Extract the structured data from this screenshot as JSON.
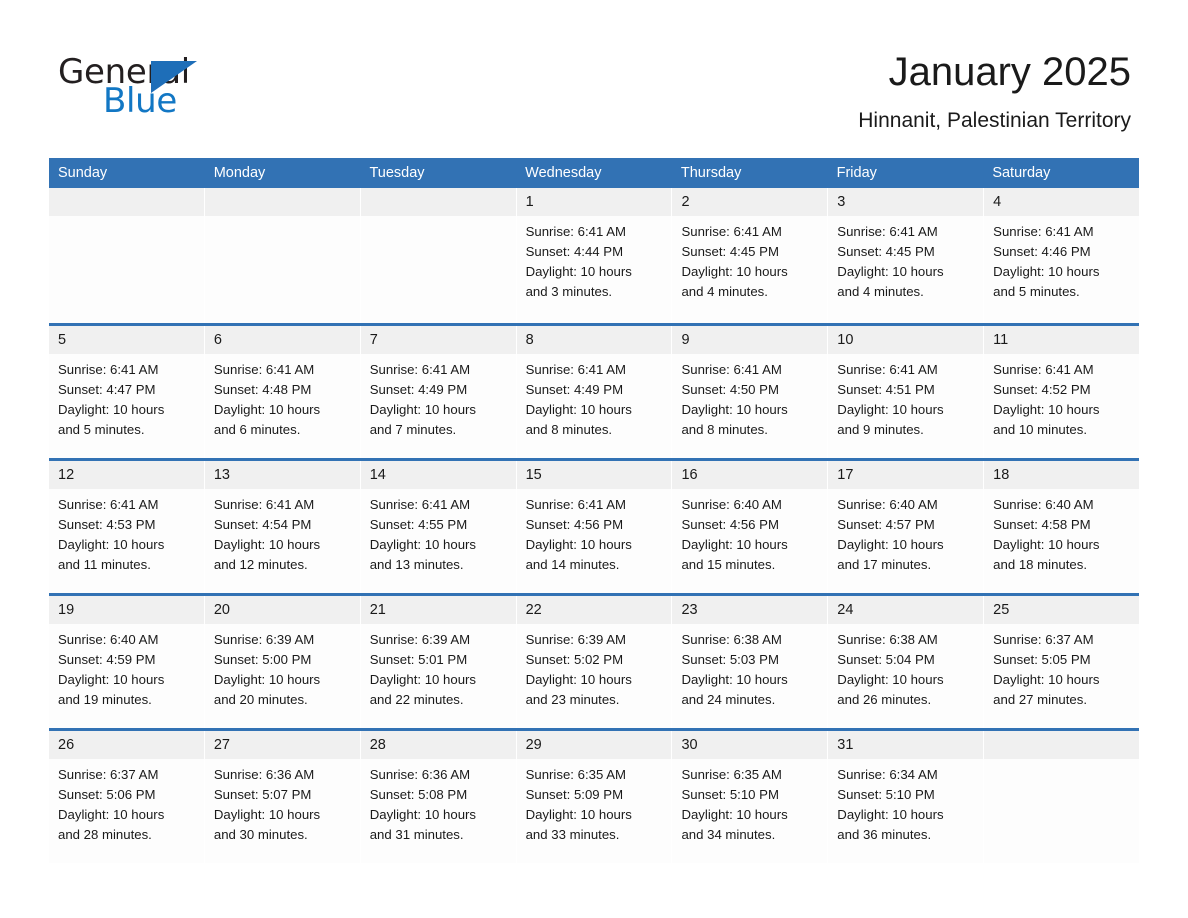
{
  "brand": {
    "word_one": "General",
    "word_two": "Blue",
    "triangle_icon": "triangle-right-icon",
    "accent_color": "#1277c4",
    "triangle_color": "#1e6eb8"
  },
  "header": {
    "title": "January 2025",
    "subtitle": "Hinnanit, Palestinian Territory"
  },
  "calendar": {
    "header_bg": "#3272b4",
    "day_head_bg": "#f0f0f0",
    "weekdays": [
      "Sunday",
      "Monday",
      "Tuesday",
      "Wednesday",
      "Thursday",
      "Friday",
      "Saturday"
    ],
    "weeks": [
      [
        {
          "day": "",
          "empty": true
        },
        {
          "day": "",
          "empty": true
        },
        {
          "day": "",
          "empty": true
        },
        {
          "day": "1",
          "sunrise": "Sunrise: 6:41 AM",
          "sunset": "Sunset: 4:44 PM",
          "daylight_1": "Daylight: 10 hours",
          "daylight_2": "and 3 minutes."
        },
        {
          "day": "2",
          "sunrise": "Sunrise: 6:41 AM",
          "sunset": "Sunset: 4:45 PM",
          "daylight_1": "Daylight: 10 hours",
          "daylight_2": "and 4 minutes."
        },
        {
          "day": "3",
          "sunrise": "Sunrise: 6:41 AM",
          "sunset": "Sunset: 4:45 PM",
          "daylight_1": "Daylight: 10 hours",
          "daylight_2": "and 4 minutes."
        },
        {
          "day": "4",
          "sunrise": "Sunrise: 6:41 AM",
          "sunset": "Sunset: 4:46 PM",
          "daylight_1": "Daylight: 10 hours",
          "daylight_2": "and 5 minutes."
        }
      ],
      [
        {
          "day": "5",
          "sunrise": "Sunrise: 6:41 AM",
          "sunset": "Sunset: 4:47 PM",
          "daylight_1": "Daylight: 10 hours",
          "daylight_2": "and 5 minutes."
        },
        {
          "day": "6",
          "sunrise": "Sunrise: 6:41 AM",
          "sunset": "Sunset: 4:48 PM",
          "daylight_1": "Daylight: 10 hours",
          "daylight_2": "and 6 minutes."
        },
        {
          "day": "7",
          "sunrise": "Sunrise: 6:41 AM",
          "sunset": "Sunset: 4:49 PM",
          "daylight_1": "Daylight: 10 hours",
          "daylight_2": "and 7 minutes."
        },
        {
          "day": "8",
          "sunrise": "Sunrise: 6:41 AM",
          "sunset": "Sunset: 4:49 PM",
          "daylight_1": "Daylight: 10 hours",
          "daylight_2": "and 8 minutes."
        },
        {
          "day": "9",
          "sunrise": "Sunrise: 6:41 AM",
          "sunset": "Sunset: 4:50 PM",
          "daylight_1": "Daylight: 10 hours",
          "daylight_2": "and 8 minutes."
        },
        {
          "day": "10",
          "sunrise": "Sunrise: 6:41 AM",
          "sunset": "Sunset: 4:51 PM",
          "daylight_1": "Daylight: 10 hours",
          "daylight_2": "and 9 minutes."
        },
        {
          "day": "11",
          "sunrise": "Sunrise: 6:41 AM",
          "sunset": "Sunset: 4:52 PM",
          "daylight_1": "Daylight: 10 hours",
          "daylight_2": "and 10 minutes."
        }
      ],
      [
        {
          "day": "12",
          "sunrise": "Sunrise: 6:41 AM",
          "sunset": "Sunset: 4:53 PM",
          "daylight_1": "Daylight: 10 hours",
          "daylight_2": "and 11 minutes."
        },
        {
          "day": "13",
          "sunrise": "Sunrise: 6:41 AM",
          "sunset": "Sunset: 4:54 PM",
          "daylight_1": "Daylight: 10 hours",
          "daylight_2": "and 12 minutes."
        },
        {
          "day": "14",
          "sunrise": "Sunrise: 6:41 AM",
          "sunset": "Sunset: 4:55 PM",
          "daylight_1": "Daylight: 10 hours",
          "daylight_2": "and 13 minutes."
        },
        {
          "day": "15",
          "sunrise": "Sunrise: 6:41 AM",
          "sunset": "Sunset: 4:56 PM",
          "daylight_1": "Daylight: 10 hours",
          "daylight_2": "and 14 minutes."
        },
        {
          "day": "16",
          "sunrise": "Sunrise: 6:40 AM",
          "sunset": "Sunset: 4:56 PM",
          "daylight_1": "Daylight: 10 hours",
          "daylight_2": "and 15 minutes."
        },
        {
          "day": "17",
          "sunrise": "Sunrise: 6:40 AM",
          "sunset": "Sunset: 4:57 PM",
          "daylight_1": "Daylight: 10 hours",
          "daylight_2": "and 17 minutes."
        },
        {
          "day": "18",
          "sunrise": "Sunrise: 6:40 AM",
          "sunset": "Sunset: 4:58 PM",
          "daylight_1": "Daylight: 10 hours",
          "daylight_2": "and 18 minutes."
        }
      ],
      [
        {
          "day": "19",
          "sunrise": "Sunrise: 6:40 AM",
          "sunset": "Sunset: 4:59 PM",
          "daylight_1": "Daylight: 10 hours",
          "daylight_2": "and 19 minutes."
        },
        {
          "day": "20",
          "sunrise": "Sunrise: 6:39 AM",
          "sunset": "Sunset: 5:00 PM",
          "daylight_1": "Daylight: 10 hours",
          "daylight_2": "and 20 minutes."
        },
        {
          "day": "21",
          "sunrise": "Sunrise: 6:39 AM",
          "sunset": "Sunset: 5:01 PM",
          "daylight_1": "Daylight: 10 hours",
          "daylight_2": "and 22 minutes."
        },
        {
          "day": "22",
          "sunrise": "Sunrise: 6:39 AM",
          "sunset": "Sunset: 5:02 PM",
          "daylight_1": "Daylight: 10 hours",
          "daylight_2": "and 23 minutes."
        },
        {
          "day": "23",
          "sunrise": "Sunrise: 6:38 AM",
          "sunset": "Sunset: 5:03 PM",
          "daylight_1": "Daylight: 10 hours",
          "daylight_2": "and 24 minutes."
        },
        {
          "day": "24",
          "sunrise": "Sunrise: 6:38 AM",
          "sunset": "Sunset: 5:04 PM",
          "daylight_1": "Daylight: 10 hours",
          "daylight_2": "and 26 minutes."
        },
        {
          "day": "25",
          "sunrise": "Sunrise: 6:37 AM",
          "sunset": "Sunset: 5:05 PM",
          "daylight_1": "Daylight: 10 hours",
          "daylight_2": "and 27 minutes."
        }
      ],
      [
        {
          "day": "26",
          "sunrise": "Sunrise: 6:37 AM",
          "sunset": "Sunset: 5:06 PM",
          "daylight_1": "Daylight: 10 hours",
          "daylight_2": "and 28 minutes."
        },
        {
          "day": "27",
          "sunrise": "Sunrise: 6:36 AM",
          "sunset": "Sunset: 5:07 PM",
          "daylight_1": "Daylight: 10 hours",
          "daylight_2": "and 30 minutes."
        },
        {
          "day": "28",
          "sunrise": "Sunrise: 6:36 AM",
          "sunset": "Sunset: 5:08 PM",
          "daylight_1": "Daylight: 10 hours",
          "daylight_2": "and 31 minutes."
        },
        {
          "day": "29",
          "sunrise": "Sunrise: 6:35 AM",
          "sunset": "Sunset: 5:09 PM",
          "daylight_1": "Daylight: 10 hours",
          "daylight_2": "and 33 minutes."
        },
        {
          "day": "30",
          "sunrise": "Sunrise: 6:35 AM",
          "sunset": "Sunset: 5:10 PM",
          "daylight_1": "Daylight: 10 hours",
          "daylight_2": "and 34 minutes."
        },
        {
          "day": "31",
          "sunrise": "Sunrise: 6:34 AM",
          "sunset": "Sunset: 5:10 PM",
          "daylight_1": "Daylight: 10 hours",
          "daylight_2": "and 36 minutes."
        },
        {
          "day": "",
          "empty": true
        }
      ]
    ]
  }
}
